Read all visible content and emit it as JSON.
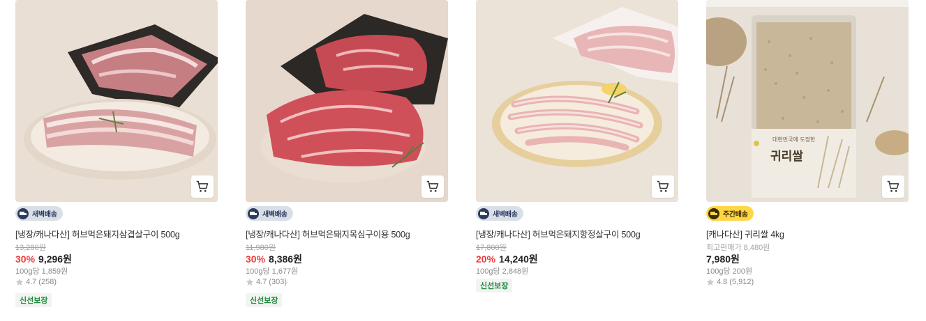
{
  "products": [
    {
      "badge": "새벽배송",
      "badge_type": "dawn",
      "name": "[냉장/캐나다산] 허브먹은돼지삼겹살구이 500g",
      "original_price": "13,280원",
      "discount": "30%",
      "price": "9,296원",
      "unit_price": "100g당 1,859원",
      "rating": "4.7",
      "reviews": "(258)",
      "tag": "신선보장",
      "image_icon": "pork-belly-image"
    },
    {
      "badge": "새벽배송",
      "badge_type": "dawn",
      "name": "[냉장/캐나다산] 허브먹은돼지목심구이용 500g",
      "original_price": "11,980원",
      "discount": "30%",
      "price": "8,386원",
      "unit_price": "100g당 1,677원",
      "rating": "4.7",
      "reviews": "(303)",
      "tag": "신선보장",
      "image_icon": "pork-neck-image"
    },
    {
      "badge": "새벽배송",
      "badge_type": "dawn",
      "name": "[냉장/캐나다산] 허브먹은돼지항정살구이 500g",
      "original_price": "17,800원",
      "discount": "20%",
      "price": "14,240원",
      "unit_price": "100g당 2,848원",
      "tag": "신선보장",
      "image_icon": "pork-jowl-image"
    },
    {
      "badge": "주간배송",
      "badge_type": "weekly",
      "name": "[캐나다산] 귀리쌀 4kg",
      "original_price": "최고판매가 8,480원",
      "price": "7,980원",
      "unit_price": "100g당 200원",
      "rating": "4.8",
      "reviews": "(5,912)",
      "image_icon": "oat-rice-bag-image",
      "package_text_small": "대한민국에 도정한",
      "package_text_large": "귀리쌀"
    }
  ],
  "icons": {
    "cart": "cart-icon",
    "star": "star-icon",
    "truck": "delivery-truck-icon"
  },
  "colors": {
    "discount": "#f03c3c",
    "dawn_badge_bg": "#d9dfe7",
    "weekly_badge_bg": "#ffd645",
    "fresh_tag_text": "#1e8a3c",
    "muted_text": "#8a8a8a"
  }
}
